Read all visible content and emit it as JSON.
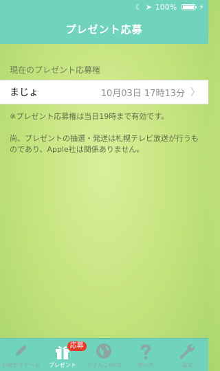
{
  "status_bar": {
    "moon_icon": "moon-icon",
    "location_icon": "location-arrow-icon",
    "battery_percent": "100%",
    "charging_icon": "bolt-icon"
  },
  "nav": {
    "title": "プレゼント応募"
  },
  "section": {
    "label": "現在のプレゼント応募権"
  },
  "entry_row": {
    "title": "まじょ",
    "detail": "10月03日 17時13分"
  },
  "notes": {
    "validity": "※プレゼント応募権は当日19時まで有効です。",
    "disclaimer": "尚、プレゼントの抽選・発送は札幌テレビ放送が行うものであり、Apple社は関係ありません。"
  },
  "tab_bar": {
    "tabs": [
      {
        "label": "お絵かきゲーム",
        "icon": "pencil-icon"
      },
      {
        "label": "プレゼント",
        "icon": "gift-icon",
        "badge": "応募"
      },
      {
        "label": "どさんこWEB",
        "icon": "globe-icon"
      },
      {
        "label": "使い方",
        "icon": "question-icon"
      },
      {
        "label": "設定",
        "icon": "wrench-icon"
      }
    ]
  },
  "colors": {
    "accent": "#6fd3be",
    "background": "#c3e27c",
    "badge": "#e8392a"
  }
}
